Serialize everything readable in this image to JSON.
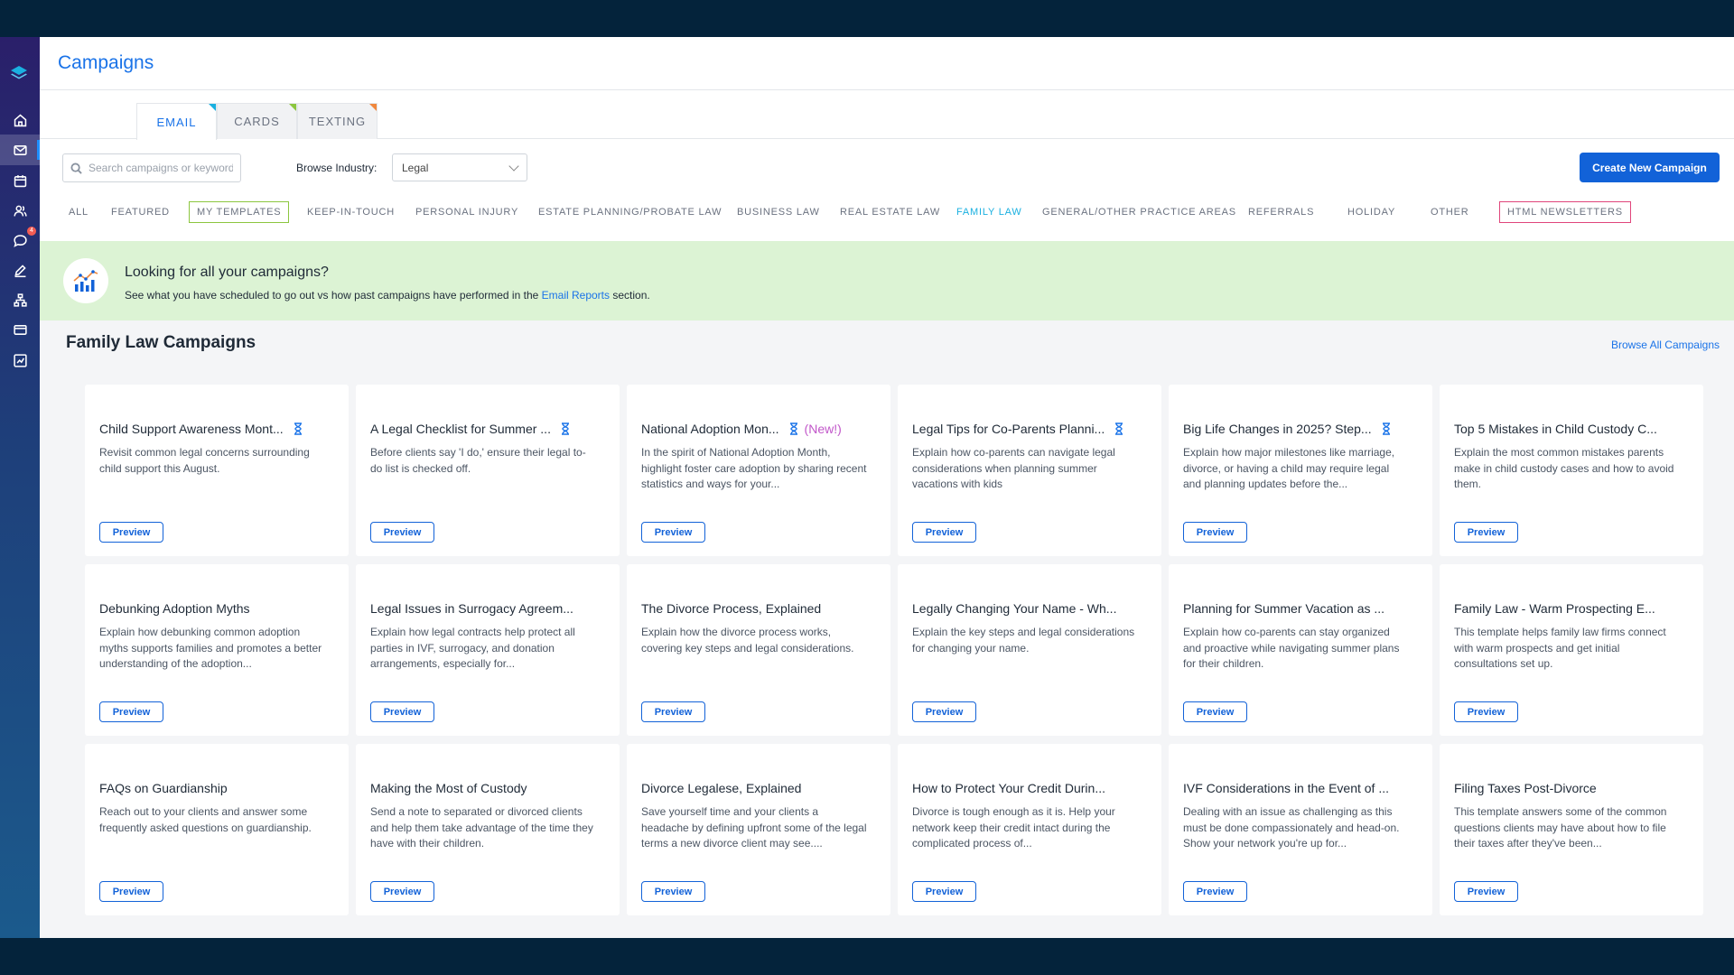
{
  "app": {
    "title": "Campaigns"
  },
  "sidebar": {
    "logo": "stack-logo",
    "items": [
      {
        "icon": "home-icon"
      },
      {
        "icon": "mail-icon",
        "active": true
      },
      {
        "icon": "calendar-icon"
      },
      {
        "icon": "contacts-icon"
      },
      {
        "icon": "chat-icon",
        "badge": "4"
      },
      {
        "icon": "edit-icon"
      },
      {
        "icon": "hierarchy-icon"
      },
      {
        "icon": "card-icon"
      },
      {
        "icon": "reports-icon"
      }
    ]
  },
  "tabs": [
    {
      "label": "EMAIL",
      "active": true,
      "corner": "#1ab0e0"
    },
    {
      "label": "CARDS",
      "corner": "#8cc63f"
    },
    {
      "label": "TEXTING",
      "corner": "#f0883e"
    }
  ],
  "toolbar": {
    "search_placeholder": "Search campaigns or keywords",
    "browse_label": "Browse Industry:",
    "industry": "Legal",
    "create_label": "Create New Campaign"
  },
  "categories": [
    {
      "label": "ALL"
    },
    {
      "label": "FEATURED"
    },
    {
      "label": "MY TEMPLATES",
      "style": "boxed-green"
    },
    {
      "label": "KEEP-IN-TOUCH"
    },
    {
      "label": "PERSONAL INJURY"
    },
    {
      "label": "ESTATE PLANNING/PROBATE LAW"
    },
    {
      "label": "BUSINESS LAW"
    },
    {
      "label": "REAL ESTATE LAW"
    },
    {
      "label": "FAMILY LAW",
      "active": true
    },
    {
      "label": "GENERAL/OTHER PRACTICE AREAS"
    },
    {
      "label": "REFERRALS"
    },
    {
      "label": "HOLIDAY"
    },
    {
      "label": "OTHER"
    },
    {
      "label": "HTML NEWSLETTERS",
      "style": "boxed-pink"
    }
  ],
  "banner": {
    "title": "Looking for all your campaigns?",
    "text_before": "See what you have scheduled to go out vs how past campaigns have performed in the",
    "link": "Email Reports",
    "text_after": "section."
  },
  "section": {
    "title": "Family Law Campaigns",
    "browse_all": "Browse All Campaigns"
  },
  "preview_label": "Preview",
  "cards": [
    {
      "title": "Child Support Awareness Mont...",
      "hourglass": true,
      "desc": "Revisit common legal concerns surrounding child support this August."
    },
    {
      "title": "A Legal Checklist for Summer ...",
      "hourglass": true,
      "desc": "Before clients say 'I do,' ensure their legal to-do list is checked off."
    },
    {
      "title": "National Adoption Mon...",
      "hourglass": true,
      "new": "(New!)",
      "desc": "In the spirit of National Adoption Month, highlight foster care adoption by sharing recent statistics and ways for your..."
    },
    {
      "title": "Legal Tips for Co-Parents Planni...",
      "hourglass": true,
      "desc": "Explain how co-parents can navigate legal considerations when planning summer vacations with kids"
    },
    {
      "title": "Big Life Changes in 2025? Step...",
      "hourglass": true,
      "desc": "Explain how major milestones like marriage, divorce, or having a child may require legal and planning updates before the..."
    },
    {
      "title": "Top 5 Mistakes in Child Custody C...",
      "desc": "Explain the most common mistakes parents make in child custody cases and how to avoid them."
    },
    {
      "title": "Debunking Adoption Myths",
      "desc": "Explain how debunking common adoption myths supports families and promotes a better understanding of the adoption..."
    },
    {
      "title": "Legal Issues in Surrogacy Agreem...",
      "desc": "Explain how legal contracts help protect all parties in IVF, surrogacy, and donation arrangements, especially for..."
    },
    {
      "title": "The Divorce Process, Explained",
      "desc": "Explain how the divorce process works, covering key steps and legal considerations."
    },
    {
      "title": "Legally Changing Your Name - Wh...",
      "desc": "Explain the key steps and legal considerations for changing your name."
    },
    {
      "title": "Planning for Summer Vacation as ...",
      "desc": "Explain how co-parents can stay organized and proactive while navigating summer plans for their children."
    },
    {
      "title": "Family Law - Warm Prospecting E...",
      "desc": "This template helps family law firms connect with warm prospects and get initial consultations set up."
    },
    {
      "title": "FAQs on Guardianship",
      "desc": "Reach out to your clients and answer some frequently asked questions on guardianship."
    },
    {
      "title": "Making the Most of Custody",
      "desc": "Send a note to separated or divorced clients and help them take advantage of the time they have with their children."
    },
    {
      "title": "Divorce Legalese, Explained",
      "desc": "Save yourself time and your clients a headache by defining upfront some of the legal terms a new divorce client may see...."
    },
    {
      "title": "How to Protect Your Credit Durin...",
      "desc": "Divorce is tough enough as it is. Help your network keep their credit intact during the complicated process of..."
    },
    {
      "title": "IVF Considerations in the Event of ...",
      "desc": "Dealing with an issue as challenging as this must be done compassionately and head-on. Show your network you're up for..."
    },
    {
      "title": "Filing Taxes Post-Divorce",
      "desc": "This template answers some of the common questions clients may have about how to file their taxes after they've been..."
    }
  ]
}
